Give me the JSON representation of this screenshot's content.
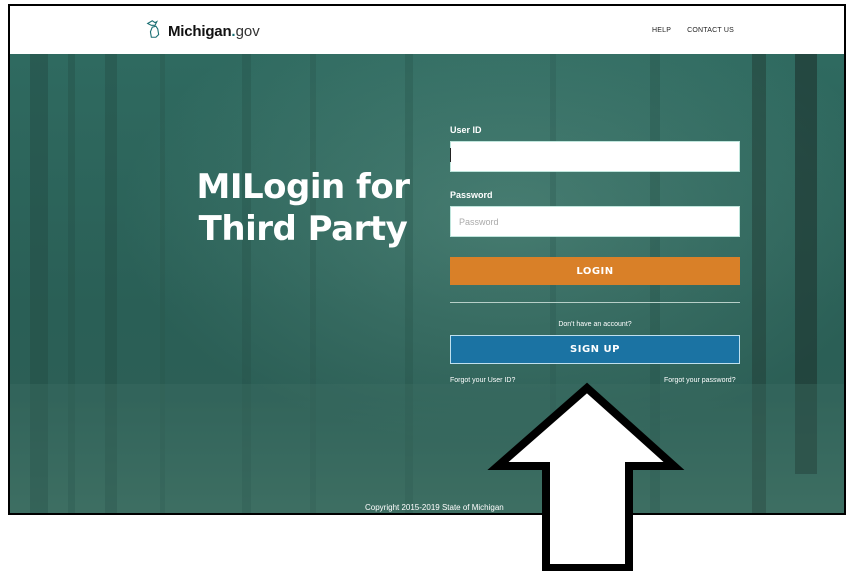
{
  "header": {
    "logo_main": "Michigan",
    "logo_dot": ".",
    "logo_tld": "gov",
    "nav": [
      {
        "label": "HELP"
      },
      {
        "label": "CONTACT US"
      }
    ]
  },
  "hero": {
    "title_line1": "MILogin for",
    "title_line2": "Third Party"
  },
  "login_form": {
    "user_id_label": "User ID",
    "user_id_value": "",
    "password_label": "Password",
    "password_placeholder": "Password",
    "login_button": "LOGIN",
    "no_account_text": "Don't have an account?",
    "signup_button": "SIGN UP",
    "forgot_user_id": "Forgot your User ID?",
    "forgot_password": "Forgot your password?"
  },
  "footer": {
    "copyright": "Copyright 2015-2019 State of Michigan"
  },
  "colors": {
    "background": "#2d655b",
    "login_button": "#d98028",
    "signup_button": "#1b73a3",
    "logo_dot": "#1a6f73"
  },
  "icons": {
    "logo": "michigan-state-outline-icon",
    "annotation": "up-arrow-icon"
  }
}
